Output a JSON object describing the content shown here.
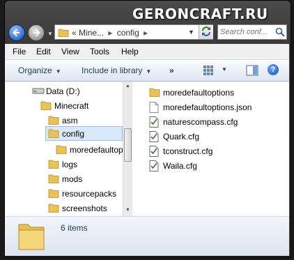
{
  "watermark": "GERONCRAFT.RU",
  "address": {
    "overflow": "«",
    "crumb1": "Mine...",
    "crumb2": "config"
  },
  "search": {
    "placeholder": "Search conf..."
  },
  "menu": [
    "File",
    "Edit",
    "View",
    "Tools",
    "Help"
  ],
  "toolbar": {
    "organize": "Organize",
    "include": "Include in library",
    "more": "»"
  },
  "nav_tree": [
    {
      "label": "Data (D:)",
      "kind": "drive"
    },
    {
      "label": "Minecraft",
      "kind": "folder"
    },
    {
      "label": "asm",
      "kind": "folder"
    },
    {
      "label": "config",
      "kind": "folder",
      "selected": true
    },
    {
      "label": "moredefaultop",
      "kind": "folder"
    },
    {
      "label": "logs",
      "kind": "folder"
    },
    {
      "label": "mods",
      "kind": "folder"
    },
    {
      "label": "resourcepacks",
      "kind": "folder"
    },
    {
      "label": "screenshots",
      "kind": "folder"
    }
  ],
  "files": [
    {
      "name": "moredefaultoptions",
      "type": "folder"
    },
    {
      "name": "moredefaultoptions.json",
      "type": "json-file"
    },
    {
      "name": "naturescompass.cfg",
      "type": "cfg-file"
    },
    {
      "name": "Quark.cfg",
      "type": "cfg-file"
    },
    {
      "name": "tconstruct.cfg",
      "type": "cfg-file"
    },
    {
      "name": "Waila.cfg",
      "type": "cfg-file"
    }
  ],
  "details": {
    "count": "6 items"
  },
  "colors": {
    "selection": "#d9e8fb",
    "folder": "#e8c35a",
    "accent": "#1e395b"
  }
}
